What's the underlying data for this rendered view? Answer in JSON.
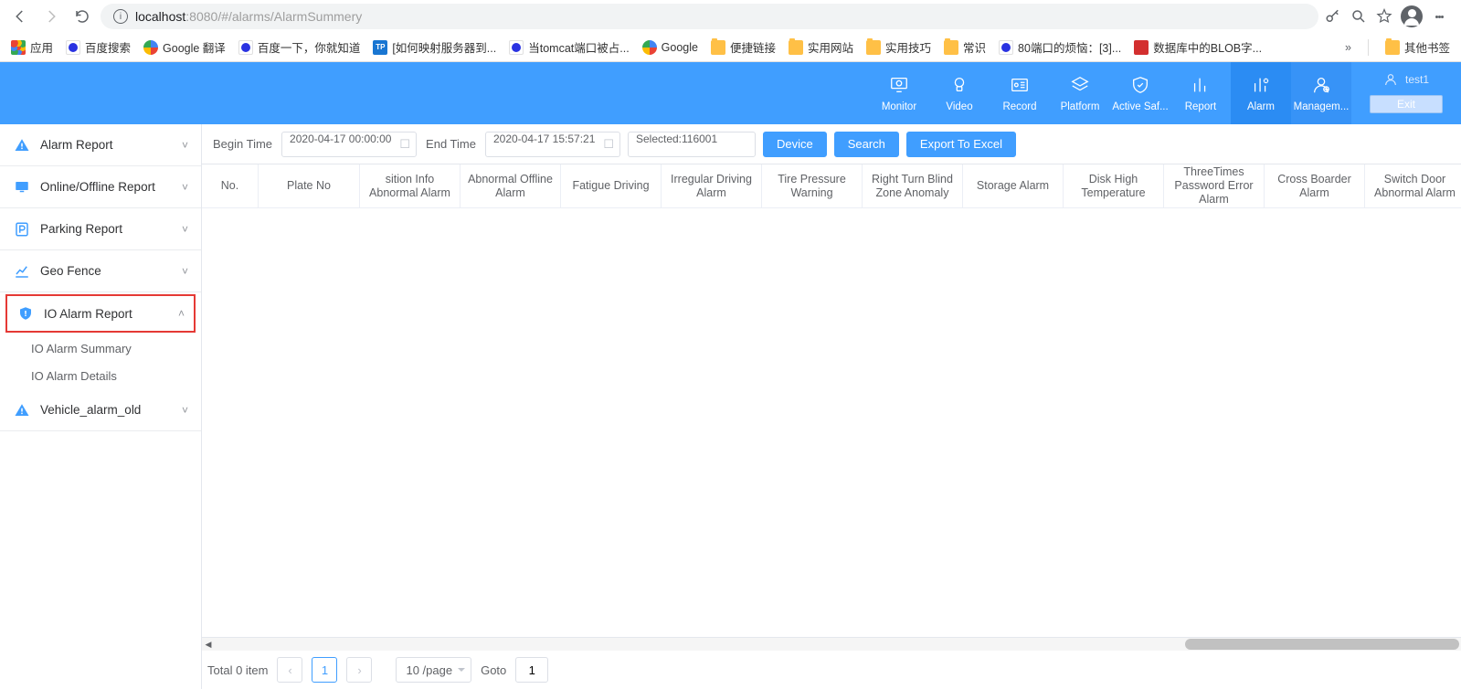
{
  "browser": {
    "url_host": "localhost",
    "url_port": ":8080",
    "url_path": "/#/alarms/AlarmSummery"
  },
  "bookmarks": {
    "apps": "应用",
    "items": [
      {
        "fav": "baidu",
        "label": "百度搜索"
      },
      {
        "fav": "google",
        "label": "Google 翻译"
      },
      {
        "fav": "baidu",
        "label": "百度一下，你就知道"
      },
      {
        "fav": "tp",
        "label": "[如何映射服务器到..."
      },
      {
        "fav": "baidu",
        "label": "当tomcat端口被占..."
      },
      {
        "fav": "google",
        "label": "Google"
      },
      {
        "fav": "folder",
        "label": "便捷链接"
      },
      {
        "fav": "folder",
        "label": "实用网站"
      },
      {
        "fav": "folder",
        "label": "实用技巧"
      },
      {
        "fav": "folder",
        "label": "常识"
      },
      {
        "fav": "baidu",
        "label": "80端口的烦恼：[3]..."
      },
      {
        "fav": "red",
        "label": "数据库中的BLOB字..."
      }
    ],
    "more": "»",
    "other": "其他书签"
  },
  "topnav": {
    "items": [
      {
        "key": "monitor",
        "label": "Monitor"
      },
      {
        "key": "video",
        "label": "Video"
      },
      {
        "key": "record",
        "label": "Record"
      },
      {
        "key": "platform",
        "label": "Platform"
      },
      {
        "key": "active",
        "label": "Active Saf..."
      },
      {
        "key": "report",
        "label": "Report"
      },
      {
        "key": "alarm",
        "label": "Alarm",
        "active": true
      },
      {
        "key": "manage",
        "label": "Managem...",
        "dark": true
      }
    ],
    "user": "test1",
    "exit": "Exit"
  },
  "sidebar": {
    "groups": [
      {
        "icon": "warning",
        "label": "Alarm Report",
        "expanded": false
      },
      {
        "icon": "monitor",
        "label": "Online/Offline Report",
        "expanded": false
      },
      {
        "icon": "parking",
        "label": "Parking Report",
        "expanded": false
      },
      {
        "icon": "chart",
        "label": "Geo Fence",
        "expanded": false
      },
      {
        "icon": "shield",
        "label": "IO Alarm Report",
        "expanded": true,
        "highlight": true,
        "children": [
          {
            "label": "IO Alarm Summary"
          },
          {
            "label": "IO Alarm Details"
          }
        ]
      },
      {
        "icon": "warning",
        "label": "Vehicle_alarm_old",
        "expanded": false
      }
    ]
  },
  "filter": {
    "begin_label": "Begin Time",
    "begin_value": "2020-04-17 00:00:00",
    "end_label": "End Time",
    "end_value": "2020-04-17 15:57:21",
    "selected_value": "Selected:116001",
    "btn_device": "Device",
    "btn_search": "Search",
    "btn_export": "Export To Excel"
  },
  "table": {
    "cols": [
      "No.",
      "Plate No",
      "sition Info Abnormal Alarm",
      "Abnormal Offline Alarm",
      "Fatigue Driving",
      "Irregular Driving Alarm",
      "Tire Pressure Warning",
      "Right Turn Blind Zone Anomaly",
      "Storage Alarm",
      "Disk High Temperature",
      "ThreeTimes Password Error Alarm",
      "Cross Boarder Alarm",
      "Switch Door Abnormal Alarm"
    ]
  },
  "pager": {
    "total": "Total 0 item",
    "page": "1",
    "size": "10 /page",
    "goto_label": "Goto",
    "goto_value": "1"
  }
}
